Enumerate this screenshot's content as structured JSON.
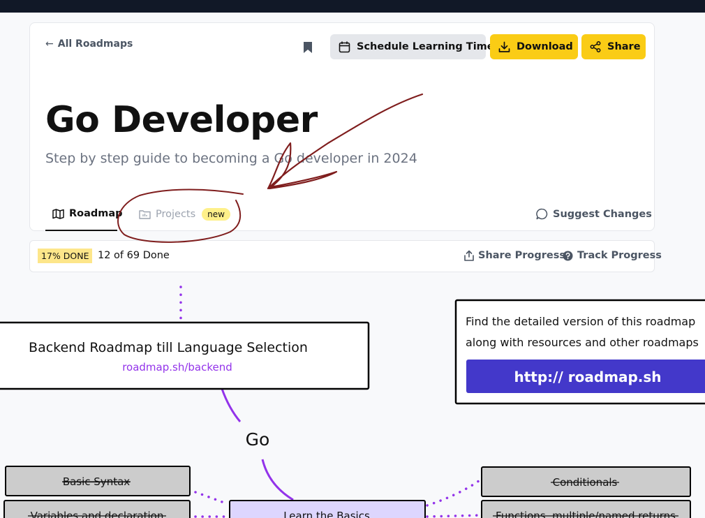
{
  "header": {
    "back_link": "All Roadmaps",
    "schedule_label": "Schedule Learning Time",
    "download_label": "Download",
    "share_label": "Share",
    "title": "Go Developer",
    "subtitle": "Step by step guide to becoming a Go developer in 2024"
  },
  "tabs": {
    "roadmap_label": "Roadmap",
    "projects_label": "Projects",
    "projects_badge": "new",
    "suggest_label": "Suggest Changes"
  },
  "progress": {
    "percent_label": "17% DONE",
    "done_text": "12 of 69 Done",
    "share_label": "Share Progress",
    "track_label": "Track Progress"
  },
  "roadmap": {
    "backend_box_title": "Backend Roadmap till Language Selection",
    "backend_box_link": "roadmap.sh/backend",
    "info_line1": "Find the detailed version of this roadmap",
    "info_line2": "along with resources and other roadmaps",
    "info_url": "http:// roadmap.sh",
    "topic_go": "Go",
    "node_basic_syntax": "Basic Syntax",
    "node_variables": "Variables and declaration",
    "node_learn_basics": "Learn the Basics",
    "node_conditionals": "Conditionals",
    "node_functions": "Functions, multiple/named returns"
  },
  "colors": {
    "accent_yellow": "#facc15",
    "purple_link": "#9333ea",
    "info_button": "#4338ca",
    "annotation": "#7f1d1d",
    "done_node": "#cccccc",
    "basics_node": "#ddd6fe"
  }
}
